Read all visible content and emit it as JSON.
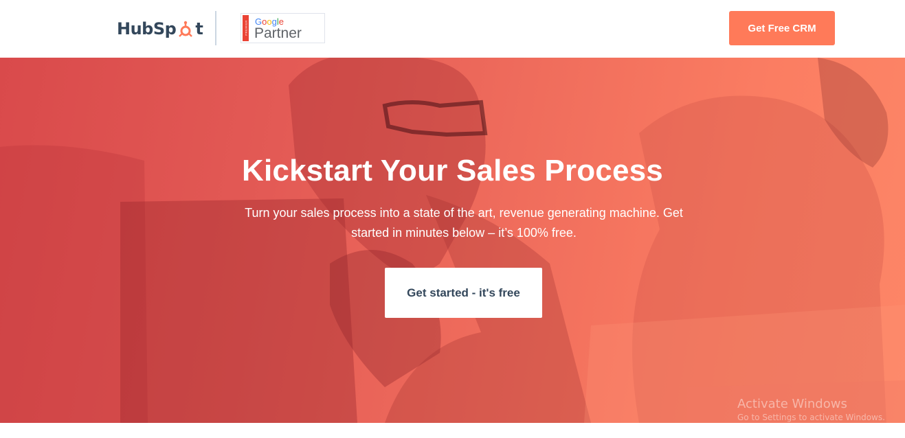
{
  "header": {
    "logo": {
      "text_left": "HubSp",
      "text_right": "t",
      "icon": "sprocket-icon"
    },
    "partner_badge": {
      "stripe_text": "PREMIER",
      "google_text": "Google",
      "partner_text": "Partner"
    },
    "cta_label": "Get Free CRM"
  },
  "hero": {
    "title": "Kickstart Your Sales Process",
    "subtitle_line1": "Turn your sales process into a state of the art, revenue generating machine. Get",
    "subtitle_line2": "started in minutes below – it’s 100% free.",
    "button_label": "Get started - it's free"
  },
  "watermark": {
    "line1": "Activate Windows",
    "line2": "Go to Settings to activate Windows."
  },
  "colors": {
    "brand_orange": "#ff7a59",
    "hero_overlay": "#ef6c5c",
    "text_dark": "#33475b"
  }
}
